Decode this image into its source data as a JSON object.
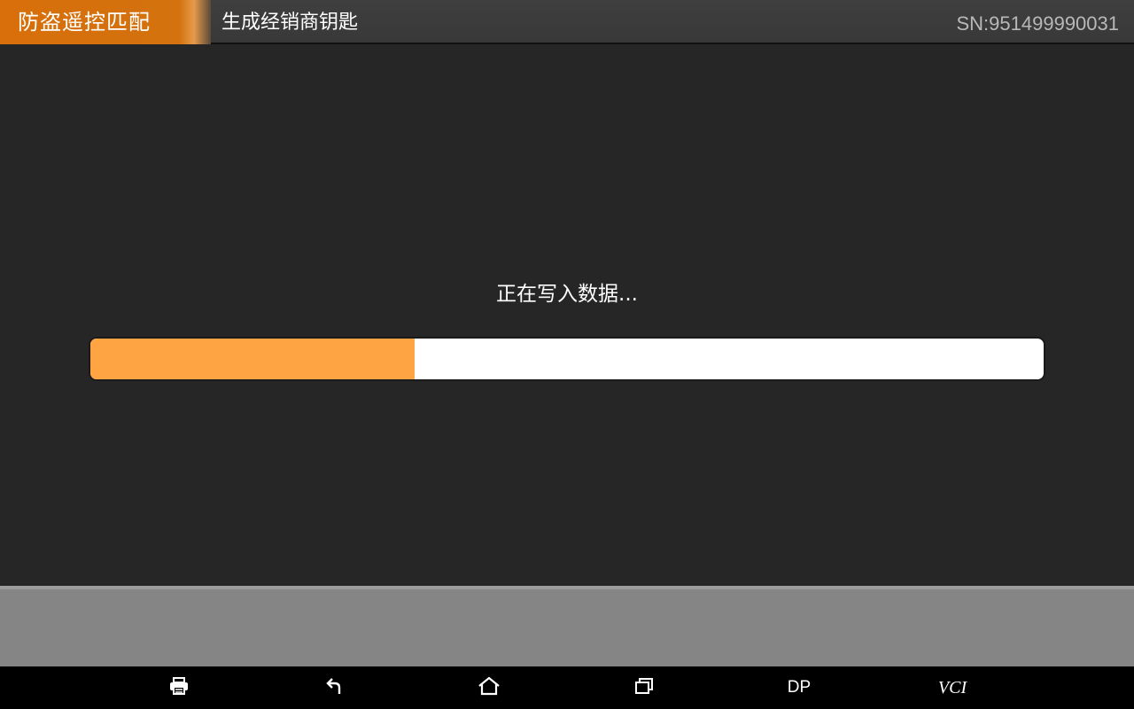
{
  "header": {
    "app_tab": "防盗遥控匹配",
    "title": "生成经销商钥匙",
    "serial": "SN:951499990031"
  },
  "main": {
    "status": "正在写入数据...",
    "progress": 0.34
  },
  "navbar": {
    "dp_label": "DP",
    "vci_label": "VCI"
  },
  "colors": {
    "accent": "#d86f0a",
    "progress_fill": "#ffa443",
    "background": "#262626",
    "panel": "#858585"
  },
  "icons": [
    "printer-icon",
    "back-icon",
    "home-icon",
    "recent-apps-icon"
  ]
}
